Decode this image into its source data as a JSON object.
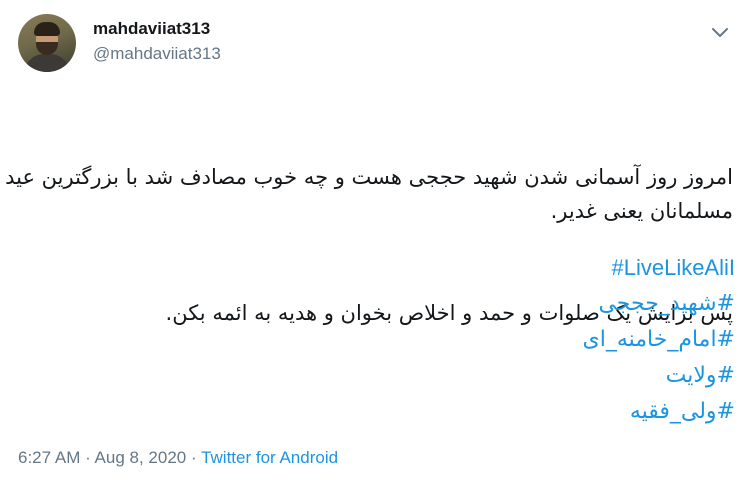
{
  "user": {
    "display_name": "mahdaviiat313",
    "handle": "@mahdaviiat313"
  },
  "tweet": {
    "paragraphs": [
      "امروز روز آسمانی شدن شهید حججی هست و چه خوب مصادف شد با بزرگترین عید مسلمانان یعنی غدیر.",
      "پس برایش یک صلوات و حمد و اخلاص بخوان و هدیه به ائمه بکن."
    ],
    "hashtags": [
      "#LiveLikeAliI",
      "#شهید_حججی",
      "#امام_خامنه_ای",
      "#ولایت",
      "#ولی_فقیه"
    ]
  },
  "meta": {
    "time": "6:27 AM",
    "separator": " · ",
    "date": "Aug 8, 2020",
    "source": "Twitter for Android"
  },
  "icons": {
    "menu": "chevron-down-icon"
  },
  "colors": {
    "link": "#1b95e0",
    "secondary_text": "#657786",
    "primary_text": "#14171a"
  }
}
